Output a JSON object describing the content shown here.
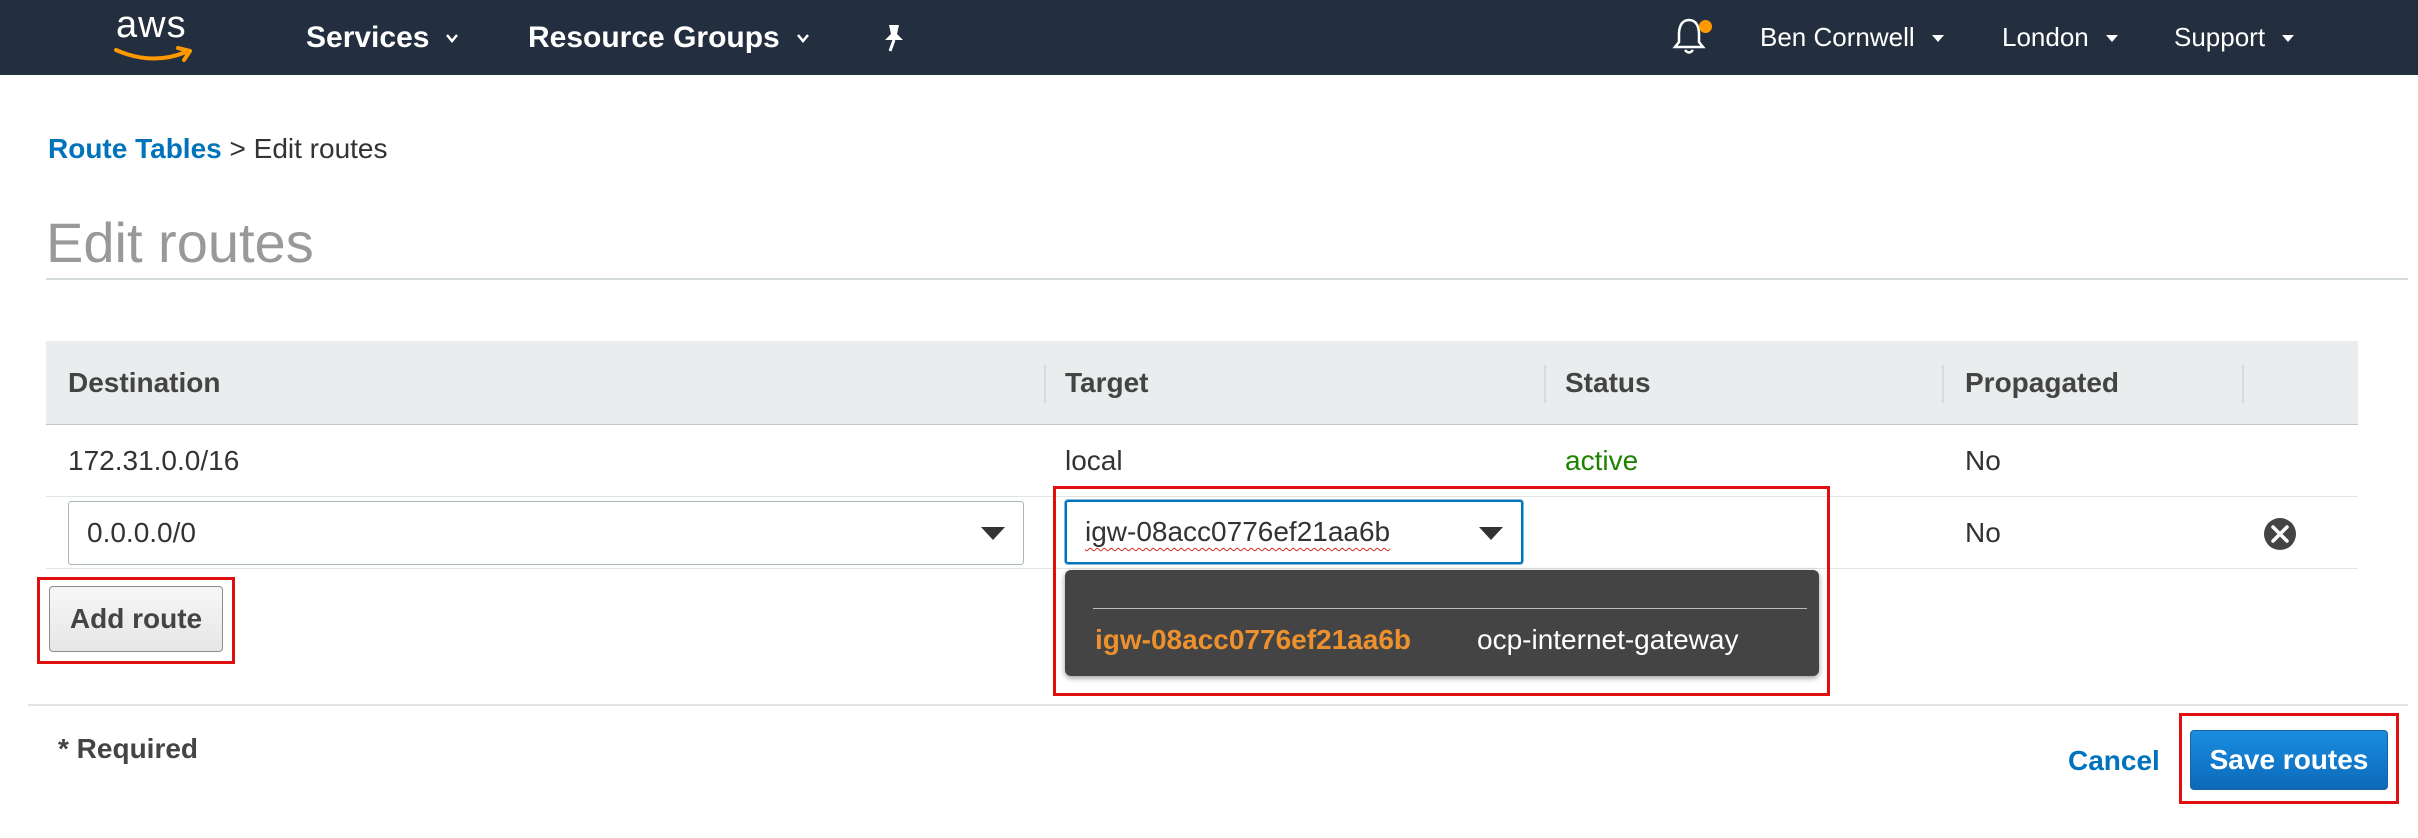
{
  "nav": {
    "logo_text": "aws",
    "services": "Services",
    "resource_groups": "Resource Groups",
    "user": "Ben Cornwell",
    "region": "London",
    "support": "Support",
    "notification_dot_color": "#ff9900"
  },
  "breadcrumb": {
    "link": "Route Tables",
    "separator": ">",
    "current": "Edit routes"
  },
  "page": {
    "title": "Edit routes"
  },
  "table": {
    "columns": [
      "Destination",
      "Target",
      "Status",
      "Propagated"
    ],
    "rows": [
      {
        "destination": "172.31.0.0/16",
        "target": "local",
        "status": "active",
        "propagated": "No"
      },
      {
        "destination": "0.0.0.0/0",
        "target": "igw-08acc0776ef21aa6b",
        "status": "",
        "propagated": "No"
      }
    ]
  },
  "dropdown": {
    "option_id": "igw-08acc0776ef21aa6b",
    "option_name": "ocp-internet-gateway"
  },
  "buttons": {
    "add_route": "Add route",
    "cancel": "Cancel",
    "save_routes": "Save routes"
  },
  "footer": {
    "required": "* Required"
  },
  "icons": {
    "bell": "bell-icon",
    "pin": "pin-icon",
    "remove": "remove-circle-icon",
    "caret": "chevron-down-icon"
  },
  "colors": {
    "nav_bg": "#232f3e",
    "link": "#0073bb",
    "active_status": "#1d8102",
    "dropdown_highlight": "#ec912d",
    "highlight_box": "#e01010"
  }
}
